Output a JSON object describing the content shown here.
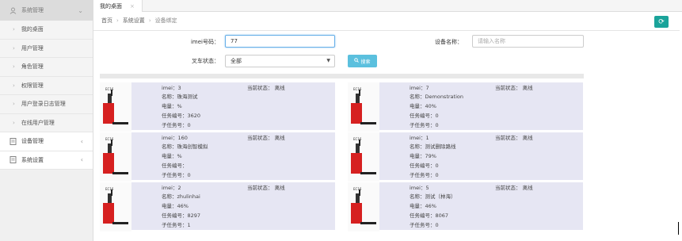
{
  "sidebar": {
    "header": "系统管理",
    "sub_items": [
      {
        "label": "我的桌面"
      },
      {
        "label": "用户管理"
      },
      {
        "label": "角色管理"
      },
      {
        "label": "权限管理"
      },
      {
        "label": "用户登录日志管理"
      },
      {
        "label": "在线用户管理"
      }
    ],
    "groups": [
      {
        "label": "设备管理"
      },
      {
        "label": "系统设置"
      }
    ]
  },
  "tabs": [
    {
      "label": "我的桌面",
      "close": "×"
    }
  ],
  "breadcrumb": {
    "home": "首页",
    "sep": "›",
    "section": "系统设置",
    "current": "设备绑定"
  },
  "form": {
    "imei_label": "imei号码：",
    "imei_value": "77",
    "device_label": "设备名称：",
    "device_placeholder": "请输入名称",
    "status_label": "叉车状态：",
    "status_value": "全部",
    "search_label": "搜索"
  },
  "colors": {
    "accent": "#1aa39a",
    "search": "#5bc0de",
    "card_bg": "#e6e6f3"
  },
  "devices": [
    {
      "imei": "imei：3",
      "status": "当前状态： 离线",
      "name": "名称：珠海测试",
      "battery": "电量：%",
      "task": "任务编号：3620",
      "subtask": "子任务号：0",
      "thumb_tag": "EC16"
    },
    {
      "imei": "imei：7",
      "status": "当前状态： 离线",
      "name": "名称：Demonstration",
      "battery": "电量：40%",
      "task": "任务编号：0",
      "subtask": "子任务号：0",
      "thumb_tag": "EC16"
    },
    {
      "imei": "imei：160",
      "status": "当前状态： 离线",
      "name": "名称：珠海创智模拟",
      "battery": "电量：%",
      "task": "任务编号：",
      "subtask": "子任务号：0",
      "thumb_tag": "EC16"
    },
    {
      "imei": "imei：1",
      "status": "当前状态： 离线",
      "name": "名称：测试删除路线",
      "battery": "电量：79%",
      "task": "任务编号：0",
      "subtask": "子任务号：0",
      "thumb_tag": "EC16"
    },
    {
      "imei": "imei：2",
      "status": "当前状态： 离线",
      "name": "名称：zhulinhai",
      "battery": "电量：46%",
      "task": "任务编号：8297",
      "subtask": "子任务号：1",
      "thumb_tag": "EC16"
    },
    {
      "imei": "imei：5",
      "status": "当前状态： 离线",
      "name": "名称：测试（林海）",
      "battery": "电量：46%",
      "task": "任务编号：8067",
      "subtask": "子任务号：0",
      "thumb_tag": "EC16"
    }
  ]
}
